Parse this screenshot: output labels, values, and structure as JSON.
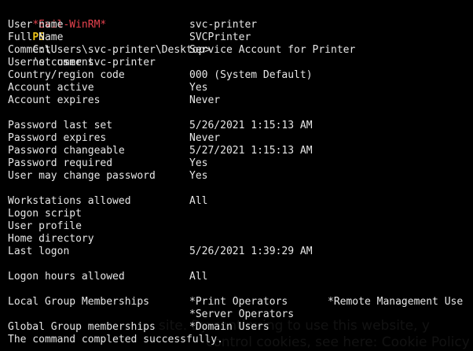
{
  "prompt": {
    "tag": "*Evil-WinRM*",
    "ps": "PS",
    "path": "C:\\Users\\svc-printer\\Desktop>",
    "command": "net user svc-printer"
  },
  "rows": [
    {
      "label": "User name",
      "value": "svc-printer"
    },
    {
      "label": "Full Name",
      "value": "SVCPrinter"
    },
    {
      "label": "Comment",
      "value": "Service Account for Printer"
    },
    {
      "label": "User's comment",
      "value": ""
    },
    {
      "label": "Country/region code",
      "value": "000 (System Default)"
    },
    {
      "label": "Account active",
      "value": "Yes"
    },
    {
      "label": "Account expires",
      "value": "Never"
    },
    {
      "label": "",
      "value": ""
    },
    {
      "label": "Password last set",
      "value": "5/26/2021 1:15:13 AM"
    },
    {
      "label": "Password expires",
      "value": "Never"
    },
    {
      "label": "Password changeable",
      "value": "5/27/2021 1:15:13 AM"
    },
    {
      "label": "Password required",
      "value": "Yes"
    },
    {
      "label": "User may change password",
      "value": "Yes"
    },
    {
      "label": "",
      "value": ""
    },
    {
      "label": "Workstations allowed",
      "value": "All"
    },
    {
      "label": "Logon script",
      "value": ""
    },
    {
      "label": "User profile",
      "value": ""
    },
    {
      "label": "Home directory",
      "value": ""
    },
    {
      "label": "Last logon",
      "value": "5/26/2021 1:39:29 AM"
    },
    {
      "label": "",
      "value": ""
    },
    {
      "label": "Logon hours allowed",
      "value": "All"
    },
    {
      "label": "",
      "value": ""
    },
    {
      "label": "Local Group Memberships",
      "value": "*Print Operators",
      "value2": "*Remote Management Use"
    },
    {
      "label": "",
      "value": "*Server Operators"
    },
    {
      "label": "Global Group memberships",
      "value": "*Domain Users"
    }
  ],
  "footer": "The command completed successfully.",
  "overlay": {
    "line1": "site. By continuing to use this website, y",
    "line2": "control cookies, see here: Cookie Policy"
  },
  "colors": {
    "background": "#000000",
    "text": "#e6e6e6",
    "prompt_tag": "#e8434f",
    "prompt_ps": "#f0c419"
  }
}
